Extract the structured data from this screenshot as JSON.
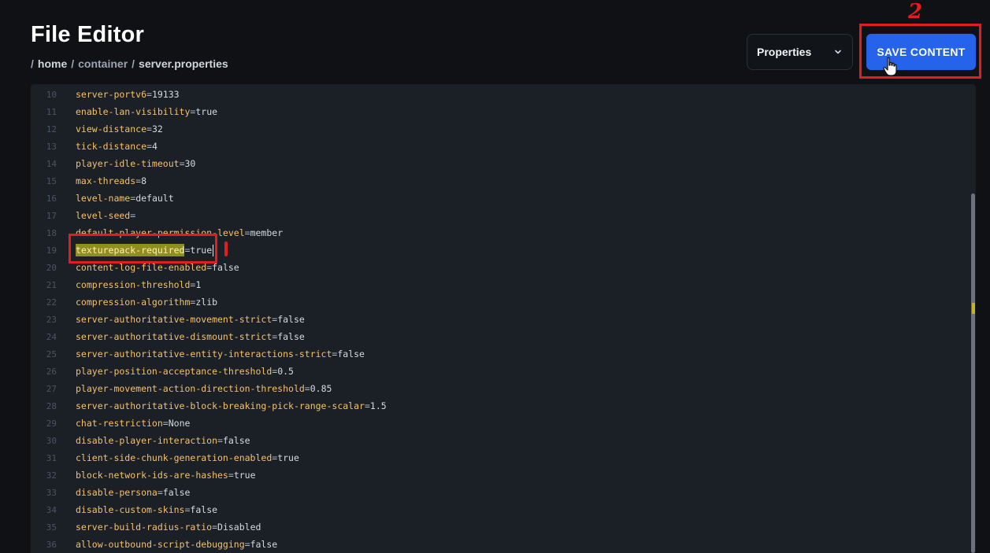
{
  "header": {
    "title": "File Editor",
    "breadcrumb": {
      "sep": "/",
      "items": [
        "home",
        "container",
        "server.properties"
      ]
    }
  },
  "toolbar": {
    "mode_select_value": "Properties",
    "save_label": "SAVE CONTENT"
  },
  "annotations": {
    "step_two_label": "2",
    "color": "#e11d1d"
  },
  "editor": {
    "cursor_line": 19,
    "highlight_color": "#8f8e1e",
    "key_color": "#f5c16c",
    "lines": [
      {
        "num": "10",
        "key": "server-portv6",
        "value": "19133"
      },
      {
        "num": "11",
        "key": "enable-lan-visibility",
        "value": "true"
      },
      {
        "num": "12",
        "key": "view-distance",
        "value": "32"
      },
      {
        "num": "13",
        "key": "tick-distance",
        "value": "4"
      },
      {
        "num": "14",
        "key": "player-idle-timeout",
        "value": "30"
      },
      {
        "num": "15",
        "key": "max-threads",
        "value": "8"
      },
      {
        "num": "16",
        "key": "level-name",
        "value": "default"
      },
      {
        "num": "17",
        "key": "level-seed",
        "value": ""
      },
      {
        "num": "18",
        "key": "default-player-permission-level",
        "value": "member"
      },
      {
        "num": "19",
        "key": "texturepack-required",
        "value": "true"
      },
      {
        "num": "20",
        "key": "content-log-file-enabled",
        "value": "false"
      },
      {
        "num": "21",
        "key": "compression-threshold",
        "value": "1"
      },
      {
        "num": "22",
        "key": "compression-algorithm",
        "value": "zlib"
      },
      {
        "num": "23",
        "key": "server-authoritative-movement-strict",
        "value": "false"
      },
      {
        "num": "24",
        "key": "server-authoritative-dismount-strict",
        "value": "false"
      },
      {
        "num": "25",
        "key": "server-authoritative-entity-interactions-strict",
        "value": "false"
      },
      {
        "num": "26",
        "key": "player-position-acceptance-threshold",
        "value": "0.5"
      },
      {
        "num": "27",
        "key": "player-movement-action-direction-threshold",
        "value": "0.85"
      },
      {
        "num": "28",
        "key": "server-authoritative-block-breaking-pick-range-scalar",
        "value": "1.5"
      },
      {
        "num": "29",
        "key": "chat-restriction",
        "value": "None"
      },
      {
        "num": "30",
        "key": "disable-player-interaction",
        "value": "false"
      },
      {
        "num": "31",
        "key": "client-side-chunk-generation-enabled",
        "value": "true"
      },
      {
        "num": "32",
        "key": "block-network-ids-are-hashes",
        "value": "true"
      },
      {
        "num": "33",
        "key": "disable-persona",
        "value": "false"
      },
      {
        "num": "34",
        "key": "disable-custom-skins",
        "value": "false"
      },
      {
        "num": "35",
        "key": "server-build-radius-ratio",
        "value": "Disabled"
      },
      {
        "num": "36",
        "key": "allow-outbound-script-debugging",
        "value": "false"
      }
    ]
  }
}
